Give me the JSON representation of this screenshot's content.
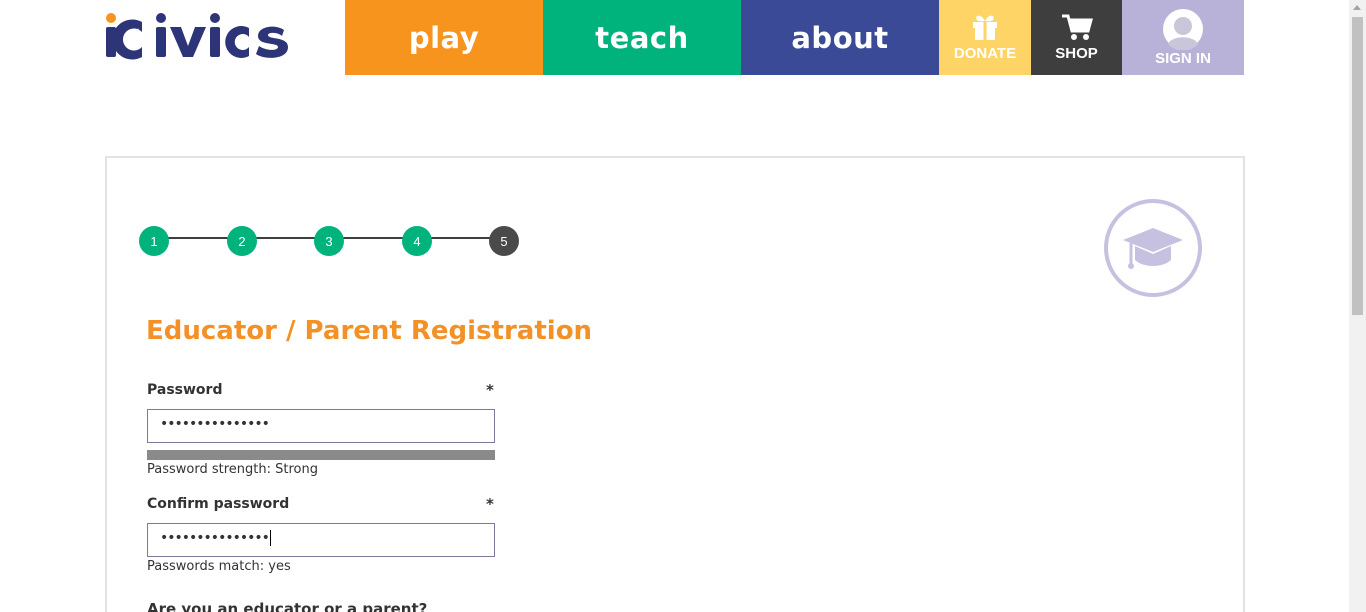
{
  "header": {
    "logo_text": "iCivics",
    "nav": {
      "play": "play",
      "teach": "teach",
      "about": "about",
      "donate": "DONATE",
      "shop": "SHOP",
      "sign_in": "SIGN IN"
    }
  },
  "steps": {
    "labels": [
      "1",
      "2",
      "3",
      "4",
      "5"
    ],
    "current": 5
  },
  "form": {
    "title": "Educator / Parent Registration",
    "password": {
      "label": "Password",
      "required_mark": "*",
      "masked_value": "•••••••••••••••",
      "strength_text": "Password strength: Strong",
      "strength_fill": 1.0
    },
    "confirm_password": {
      "label": "Confirm password",
      "required_mark": "*",
      "masked_value": "•••••••••••••••",
      "match_text": "Passwords match: yes"
    },
    "next_question_partial": "Are you an educator or a parent?"
  },
  "colors": {
    "play": "#f7941d",
    "teach": "#00b37d",
    "about": "#3b4a96",
    "donate": "#ffd466",
    "shop": "#3e3e3e",
    "sign_in": "#b8b2d9",
    "title": "#f39127",
    "step_done": "#00b37d",
    "step_current": "#4a4a4a"
  },
  "icons": [
    "logo-star-icon",
    "gift-icon",
    "cart-icon",
    "user-avatar-icon",
    "graduation-cap-icon"
  ]
}
